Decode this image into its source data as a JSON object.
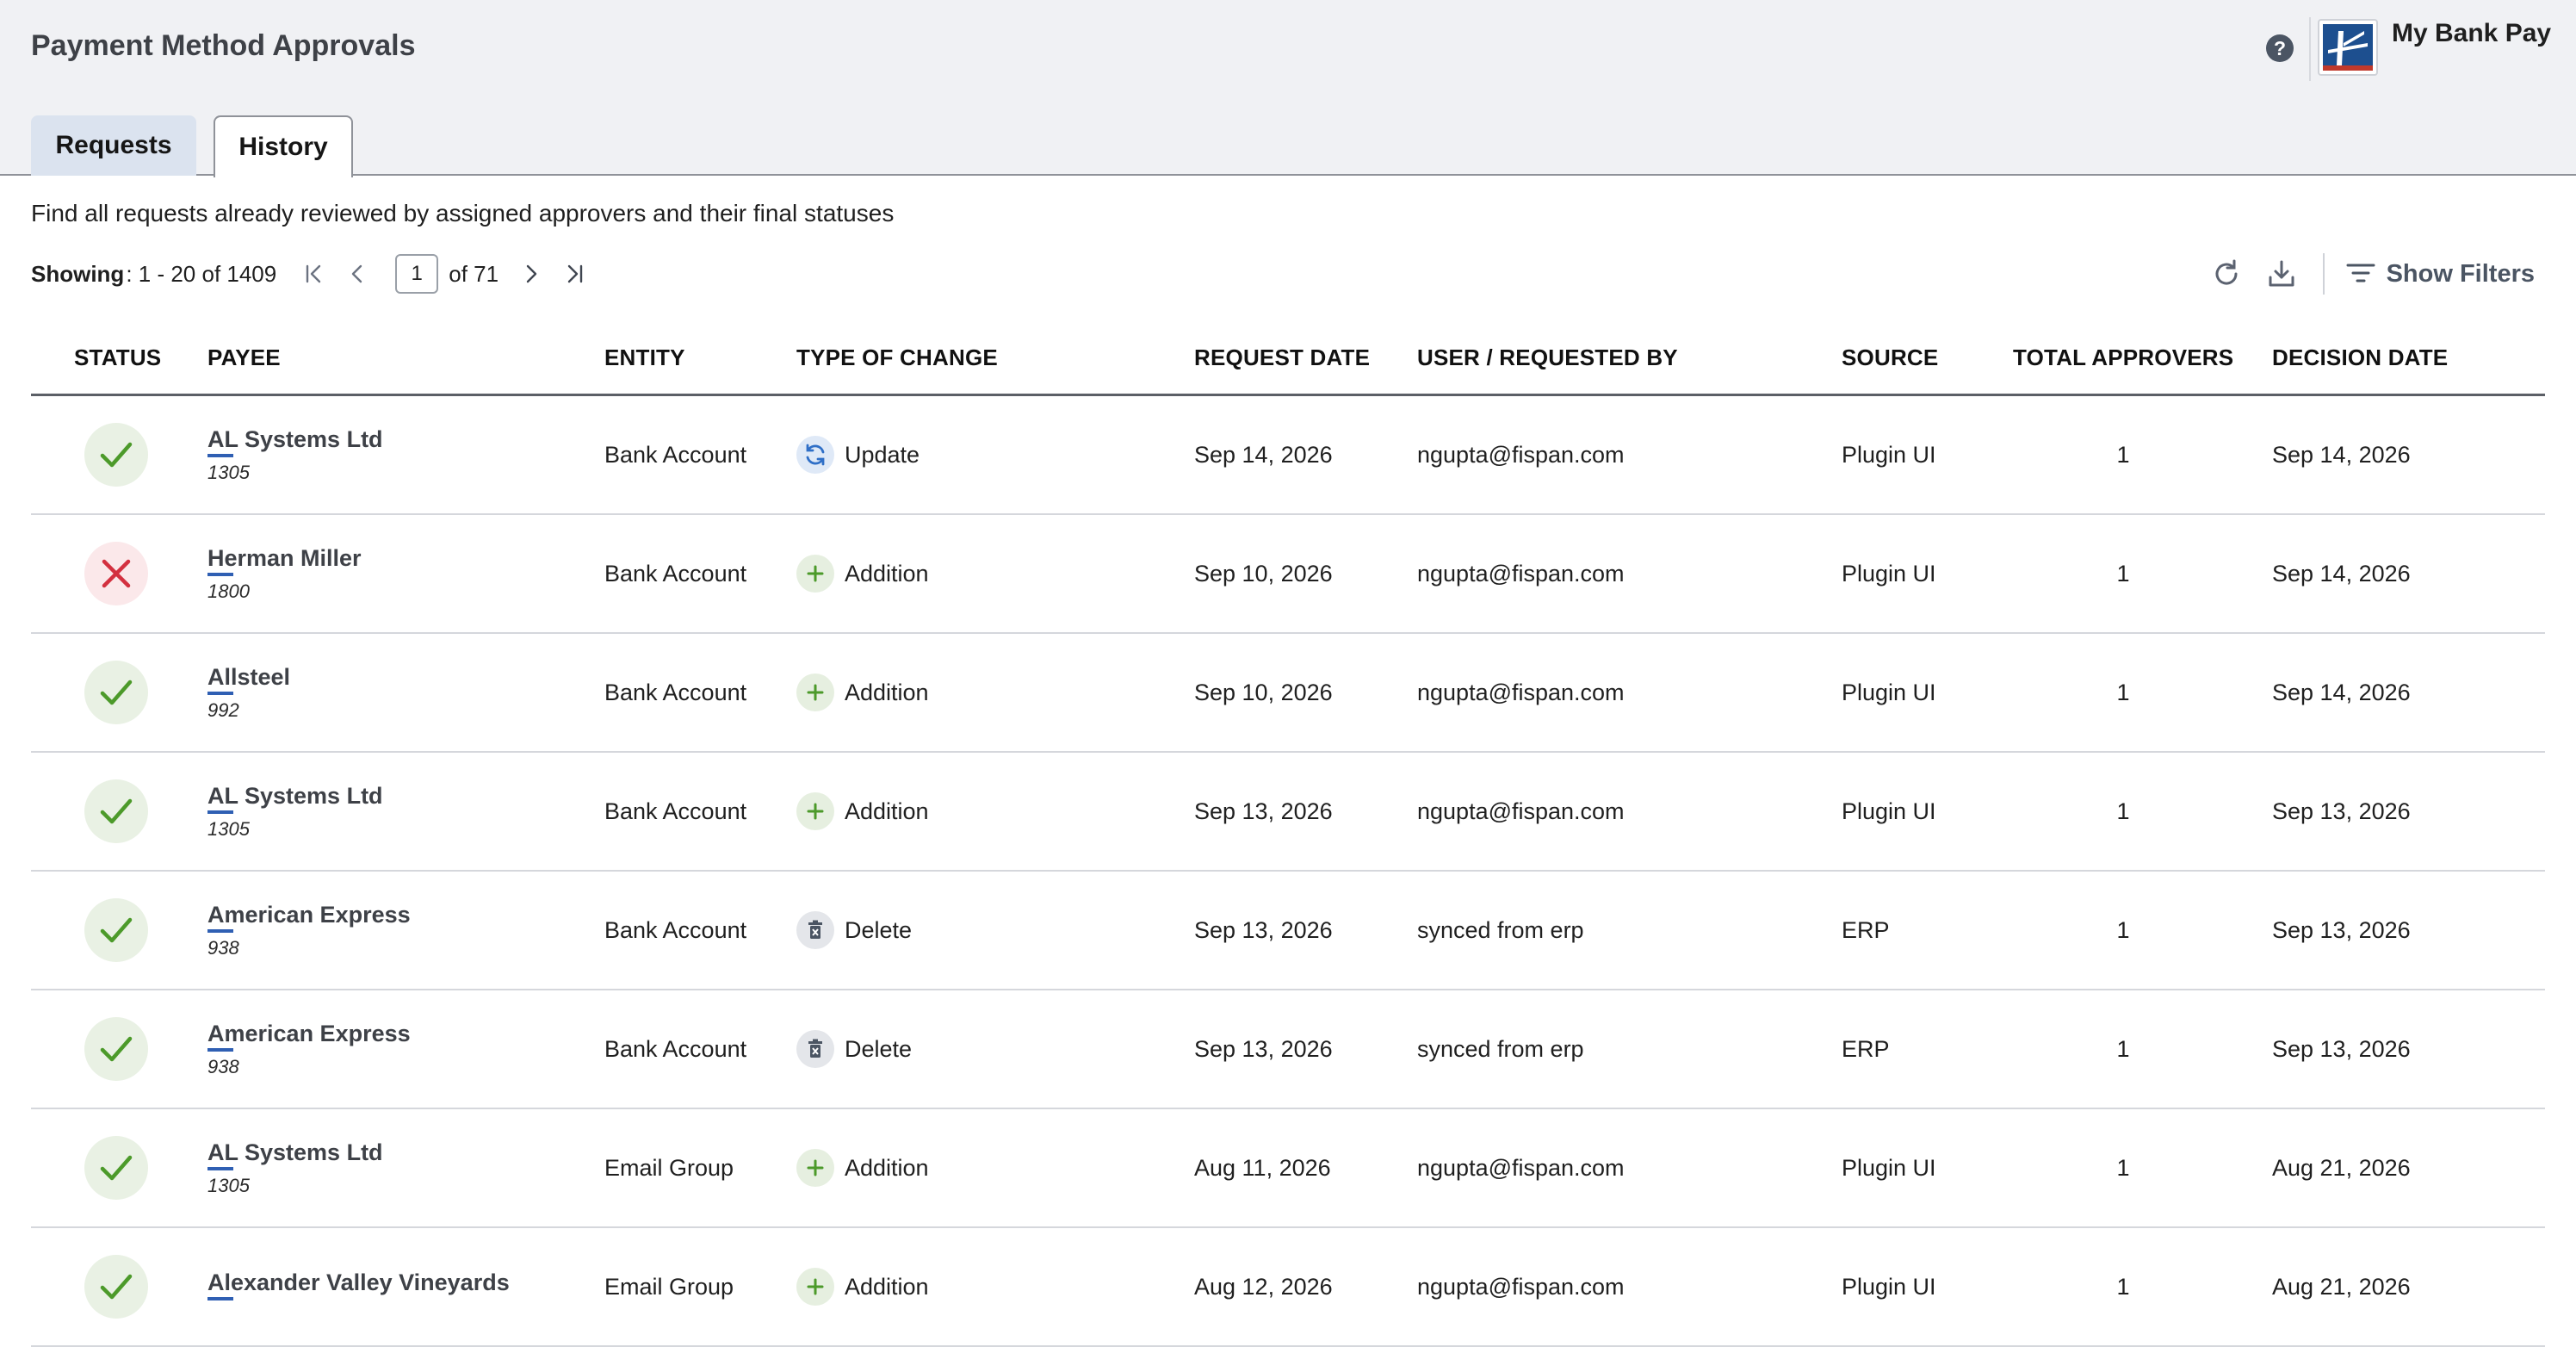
{
  "header": {
    "title": "Payment Method Approvals",
    "brand_name": "My Bank Pay"
  },
  "tabs": [
    {
      "label": "Requests",
      "active": false
    },
    {
      "label": "History",
      "active": true
    }
  ],
  "subtitle": "Find all requests already reviewed by assigned approvers and their final statuses",
  "pagination": {
    "showing_label": "Showing",
    "range": ": 1 - 20 of 1409",
    "current_page": "1",
    "of_total": "of 71"
  },
  "toolbar": {
    "show_filters_label": "Show Filters"
  },
  "columns": {
    "status": "STATUS",
    "payee": "PAYEE",
    "entity": "ENTITY",
    "type": "TYPE OF CHANGE",
    "request_date": "REQUEST DATE",
    "user": "USER / REQUESTED BY",
    "source": "SOURCE",
    "approvers": "TOTAL APPROVERS",
    "decision_date": "DECISION DATE"
  },
  "rows": [
    {
      "status": "approved",
      "payee": "AL Systems Ltd",
      "payee_id": "1305",
      "entity": "Bank Account",
      "change": "Update",
      "change_icon": "refresh-icon",
      "request_date": "Sep 14, 2026",
      "user": "ngupta@fispan.com",
      "source": "Plugin UI",
      "approvers": "1",
      "decision_date": "Sep 14, 2026"
    },
    {
      "status": "rejected",
      "payee": "Herman Miller",
      "payee_id": "1800",
      "entity": "Bank Account",
      "change": "Addition",
      "change_icon": "plus-icon",
      "request_date": "Sep 10, 2026",
      "user": "ngupta@fispan.com",
      "source": "Plugin UI",
      "approvers": "1",
      "decision_date": "Sep 14, 2026"
    },
    {
      "status": "approved",
      "payee": "Allsteel",
      "payee_id": "992",
      "entity": "Bank Account",
      "change": "Addition",
      "change_icon": "plus-icon",
      "request_date": "Sep 10, 2026",
      "user": "ngupta@fispan.com",
      "source": "Plugin UI",
      "approvers": "1",
      "decision_date": "Sep 14, 2026"
    },
    {
      "status": "approved",
      "payee": "AL Systems Ltd",
      "payee_id": "1305",
      "entity": "Bank Account",
      "change": "Addition",
      "change_icon": "plus-icon",
      "request_date": "Sep 13, 2026",
      "user": "ngupta@fispan.com",
      "source": "Plugin UI",
      "approvers": "1",
      "decision_date": "Sep 13, 2026"
    },
    {
      "status": "approved",
      "payee": "American Express",
      "payee_id": "938",
      "entity": "Bank Account",
      "change": "Delete",
      "change_icon": "trash-icon",
      "request_date": "Sep 13, 2026",
      "user": "synced from erp",
      "source": "ERP",
      "approvers": "1",
      "decision_date": "Sep 13, 2026"
    },
    {
      "status": "approved",
      "payee": "American Express",
      "payee_id": "938",
      "entity": "Bank Account",
      "change": "Delete",
      "change_icon": "trash-icon",
      "request_date": "Sep 13, 2026",
      "user": "synced from erp",
      "source": "ERP",
      "approvers": "1",
      "decision_date": "Sep 13, 2026"
    },
    {
      "status": "approved",
      "payee": "AL Systems Ltd",
      "payee_id": "1305",
      "entity": "Email Group",
      "change": "Addition",
      "change_icon": "plus-icon",
      "request_date": "Aug 11, 2026",
      "user": "ngupta@fispan.com",
      "source": "Plugin UI",
      "approvers": "1",
      "decision_date": "Aug 21, 2026"
    },
    {
      "status": "approved",
      "payee": "Alexander Valley Vineyards",
      "payee_id": "",
      "entity": "Email Group",
      "change": "Addition",
      "change_icon": "plus-icon",
      "request_date": "Aug 12, 2026",
      "user": "ngupta@fispan.com",
      "source": "Plugin UI",
      "approvers": "1",
      "decision_date": "Aug 21, 2026"
    }
  ]
}
